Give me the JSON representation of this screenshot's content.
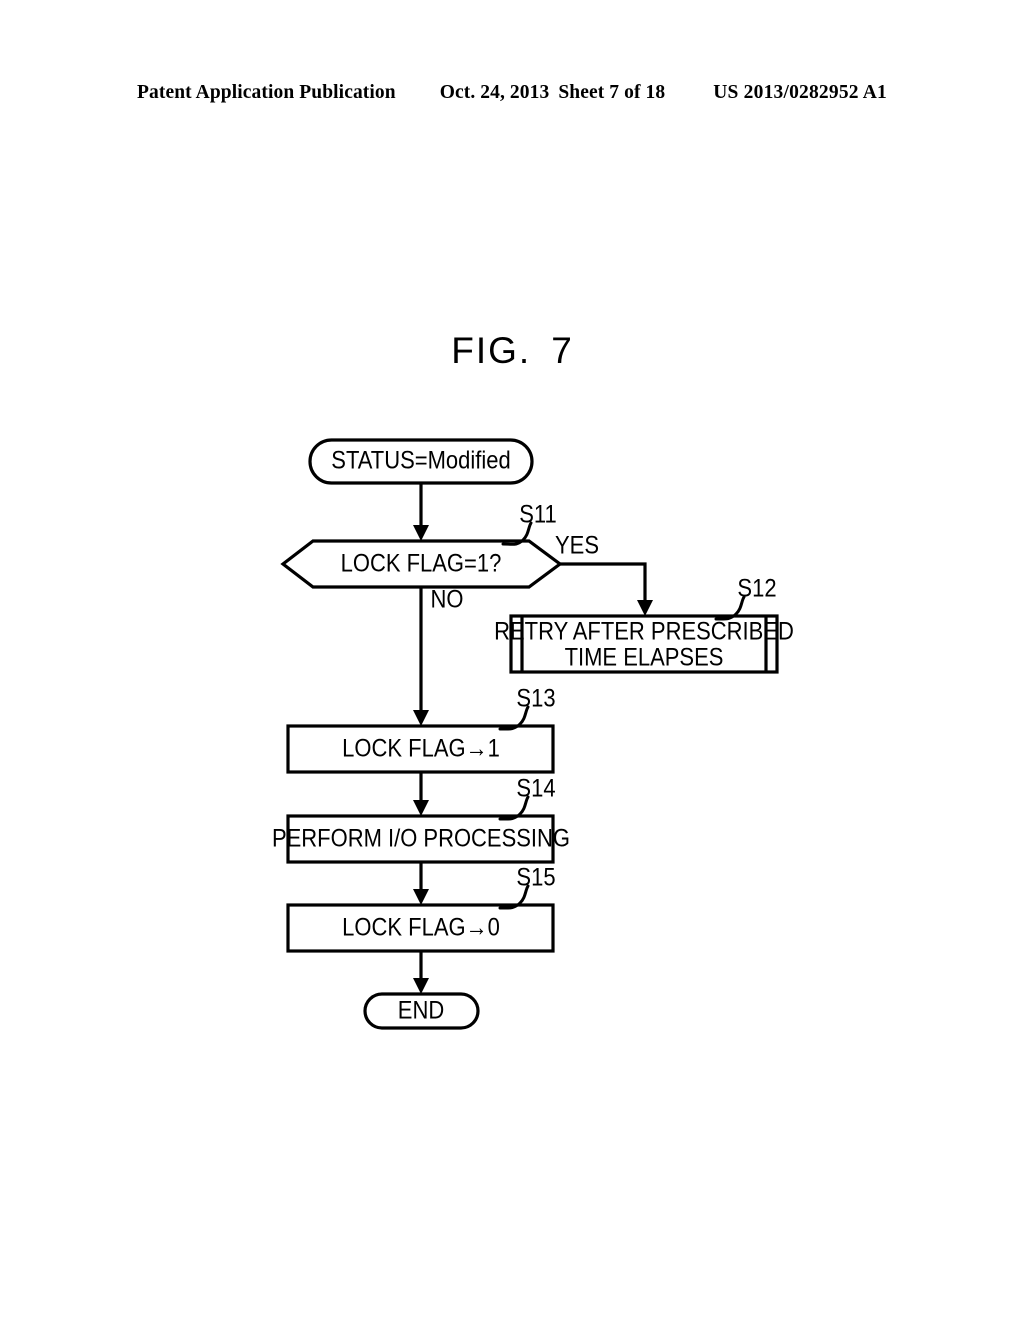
{
  "header": {
    "publication": "Patent Application Publication",
    "date": "Oct. 24, 2013",
    "sheet": "Sheet 7 of 18",
    "patent_number": "US 2013/0282952 A1"
  },
  "figure": {
    "label_word": "FIG.",
    "label_number": "7"
  },
  "flowchart": {
    "nodes": {
      "start": {
        "text": "STATUS=Modified",
        "shape": "terminator"
      },
      "decision": {
        "text": "LOCK FLAG=1?",
        "shape": "decision",
        "step_id": "S11"
      },
      "retry": {
        "line1": "RETRY AFTER PRESCRIBED",
        "line2": "TIME ELAPSES",
        "shape": "predefined-process",
        "step_id": "S12"
      },
      "lock_set": {
        "text": "LOCK FLAG→1",
        "shape": "process",
        "step_id": "S13"
      },
      "io": {
        "text": "PERFORM I/O PROCESSING",
        "shape": "process",
        "step_id": "S14"
      },
      "lock_clear": {
        "text": "LOCK FLAG→0",
        "shape": "process",
        "step_id": "S15"
      },
      "end": {
        "text": "END",
        "shape": "terminator"
      }
    },
    "branches": {
      "yes": "YES",
      "no": "NO"
    },
    "colors": {
      "stroke": "#000000",
      "fill": "#ffffff"
    }
  }
}
